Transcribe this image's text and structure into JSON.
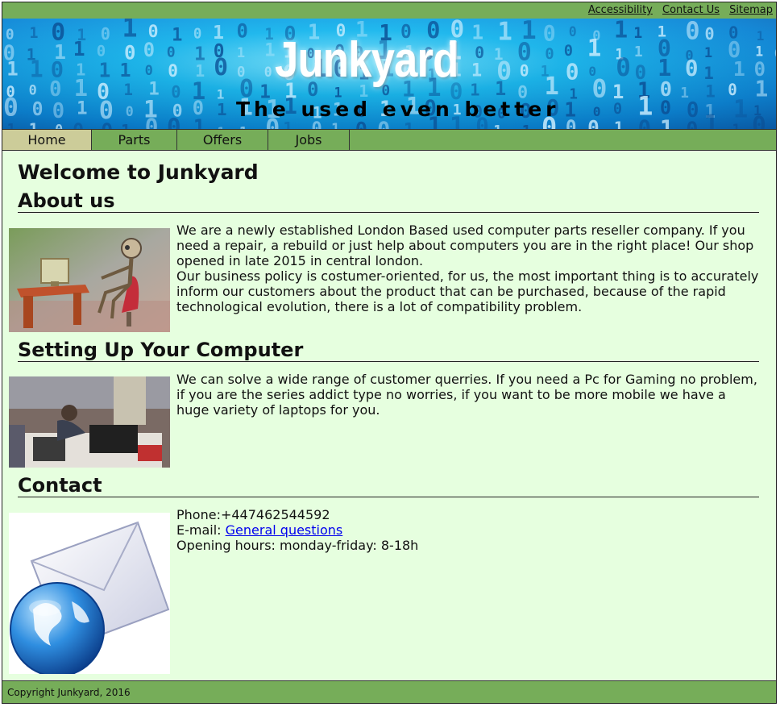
{
  "topbar": {
    "links": [
      "Accessibility",
      "Contact Us",
      "Sitemap"
    ]
  },
  "banner": {
    "title": "Junkyard",
    "tagline": "The used even better"
  },
  "nav": {
    "items": [
      "Home",
      "Parts",
      "Offers",
      "Jobs"
    ],
    "active": "Home"
  },
  "main": {
    "heading": "Welcome to Junkyard",
    "about": {
      "heading": "About us",
      "para1": "We are a newly established London Based used computer parts reseller company. If you need a repair, a rebuild or just help about computers you are in the right place! Our shop opened in late 2015 in central london.",
      "para2": "Our business policy is costumer-oriented, for us, the most important thing is to accurately inform our customers about the product that can be purchased, because of the rapid technological evolution, there is a lot of compatibility problem."
    },
    "setup": {
      "heading": "Setting Up Your Computer",
      "text": "We can solve a wide range of customer querries. If you need a Pc for Gaming no problem, if you are the series addict type no worries, if you want to be more mobile we have a huge variety of laptops for you."
    },
    "contact": {
      "heading": "Contact",
      "phone": "Phone:+447462544592",
      "email_label": "E-mail: ",
      "email_link": "General questions",
      "hours": "Opening hours: monday-friday: 8-18h"
    }
  },
  "footer": {
    "copyright": "Copyright Junkyard, 2016"
  },
  "colors": {
    "bar_green": "#76ad59",
    "content_bg": "#e6ffdf",
    "nav_active": "#cccc99",
    "link": "#0000ee"
  },
  "icons": {
    "about_image": "robot-at-computer-image",
    "setup_image": "pc-repair-workbench-image",
    "contact_image": "email-globe-icon"
  }
}
